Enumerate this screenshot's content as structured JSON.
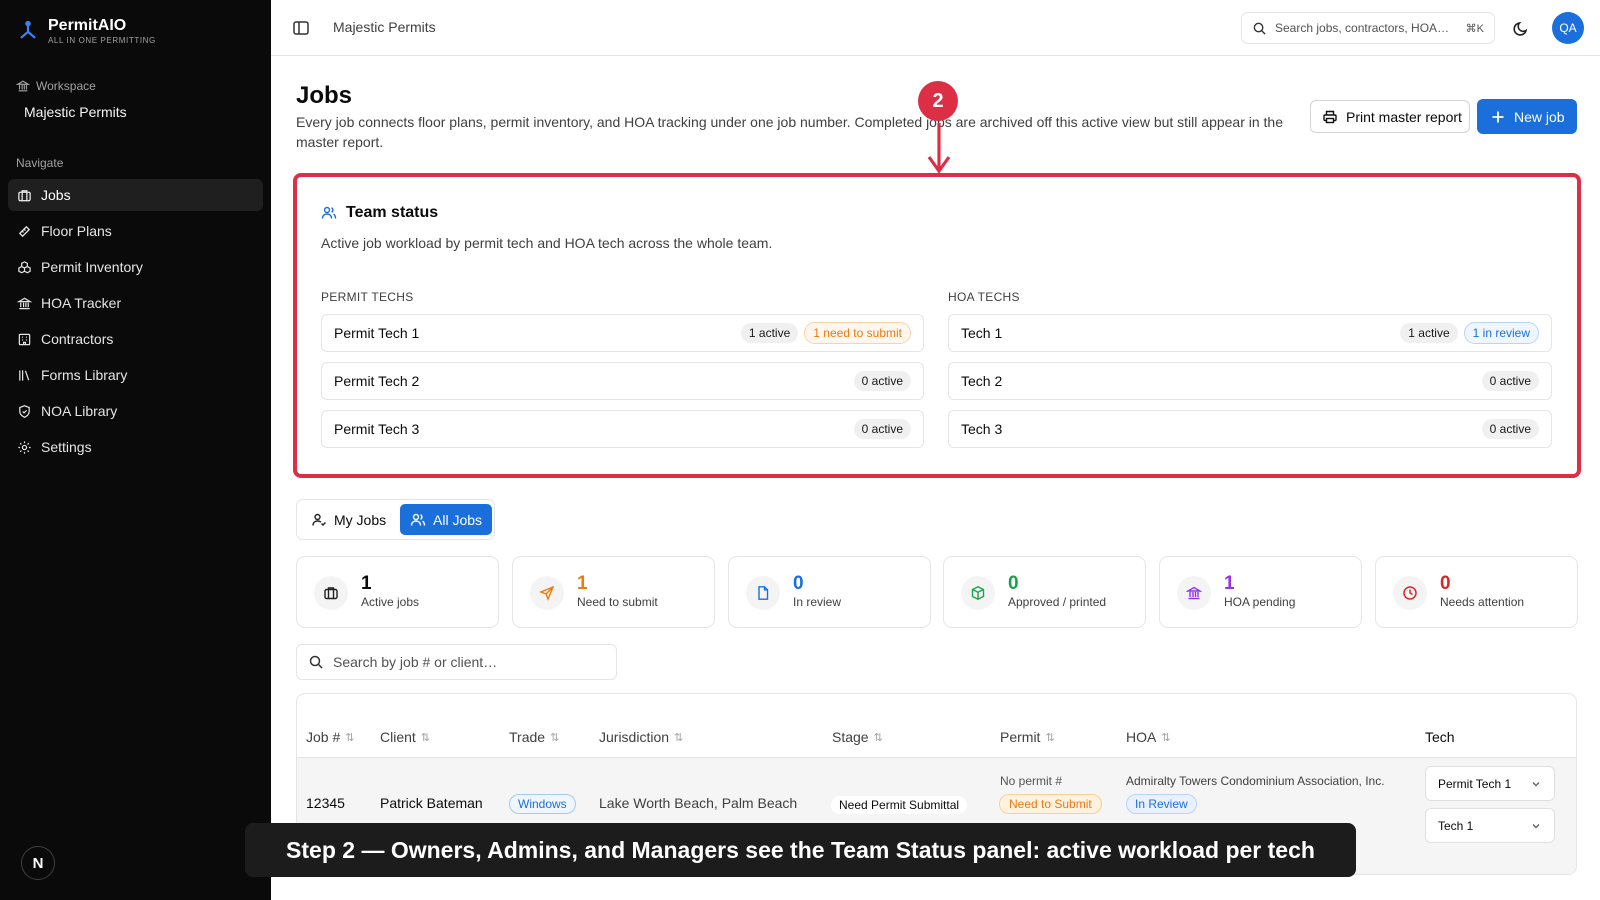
{
  "brand": {
    "name": "PermitAIO",
    "tagline": "ALL IN ONE PERMITTING"
  },
  "sidebar": {
    "workspace_label": "Workspace",
    "workspace_name": "Majestic Permits",
    "navigate_label": "Navigate",
    "items": [
      {
        "label": "Jobs",
        "icon": "briefcase-icon",
        "active": true
      },
      {
        "label": "Floor Plans",
        "icon": "ruler-icon"
      },
      {
        "label": "Permit Inventory",
        "icon": "boxes-icon"
      },
      {
        "label": "HOA Tracker",
        "icon": "bank-icon"
      },
      {
        "label": "Contractors",
        "icon": "building-icon"
      },
      {
        "label": "Forms Library",
        "icon": "library-icon"
      },
      {
        "label": "NOA Library",
        "icon": "shield-icon"
      },
      {
        "label": "Settings",
        "icon": "gear-icon"
      }
    ],
    "bottom_avatar": "N"
  },
  "topbar": {
    "title": "Majestic Permits",
    "search_placeholder": "Search jobs, contractors, HOA…",
    "search_shortcut": "⌘K",
    "avatar": "QA"
  },
  "header": {
    "title": "Jobs",
    "description": "Every job connects floor plans, permit inventory, and HOA tracking under one job number. Completed jobs are archived off this active view but still appear in the master report.",
    "print_label": "Print master report",
    "new_label": "New job"
  },
  "step_marker": "2",
  "team": {
    "title": "Team status",
    "subtitle": "Active job workload by permit tech and HOA tech across the whole team.",
    "permit_label": "PERMIT TECHS",
    "hoa_label": "HOA TECHS",
    "permit_techs": [
      {
        "name": "Permit Tech 1",
        "active": "1 active",
        "extra": "1 need to submit"
      },
      {
        "name": "Permit Tech 2",
        "active": "0 active"
      },
      {
        "name": "Permit Tech 3",
        "active": "0 active"
      }
    ],
    "hoa_techs": [
      {
        "name": "Tech 1",
        "active": "1 active",
        "extra": "1 in review"
      },
      {
        "name": "Tech 2",
        "active": "0 active"
      },
      {
        "name": "Tech 3",
        "active": "0 active"
      }
    ]
  },
  "tabs": {
    "my": "My Jobs",
    "all": "All Jobs"
  },
  "stats": [
    {
      "value": "1",
      "label": "Active jobs",
      "color": "#0a0a0a",
      "icon": "briefcase-icon"
    },
    {
      "value": "1",
      "label": "Need to submit",
      "color": "#ea7a12",
      "icon": "send-icon"
    },
    {
      "value": "0",
      "label": "In review",
      "color": "#1a6fdb",
      "icon": "file-icon"
    },
    {
      "value": "0",
      "label": "Approved / printed",
      "color": "#16a34a",
      "icon": "package-check-icon"
    },
    {
      "value": "1",
      "label": "HOA pending",
      "color": "#9333ea",
      "icon": "bank-icon"
    },
    {
      "value": "0",
      "label": "Needs attention",
      "color": "#dc2626",
      "icon": "clock-icon"
    }
  ],
  "job_search_placeholder": "Search by job # or client…",
  "table": {
    "headers": [
      "Job #",
      "Client",
      "Trade",
      "Jurisdiction",
      "Stage",
      "Permit",
      "HOA",
      "Tech"
    ],
    "row": {
      "job": "12345",
      "client": "Patrick Bateman",
      "trade": "Windows",
      "jurisdiction": "Lake Worth Beach, Palm Beach",
      "stage": "Need Permit Submittal",
      "permit_no": "No permit #",
      "permit_status": "Need to Submit",
      "hoa_name": "Admiralty Towers Condominium Association, Inc.",
      "hoa_status": "In Review",
      "permit_tech": "Permit Tech 1",
      "hoa_tech": "Tech 1"
    }
  },
  "caption": "Step 2 — Owners, Admins, and Managers see the Team Status panel: active workload per tech",
  "colors": {
    "accent": "#1a6fdb",
    "highlight": "#dc2f45",
    "sidebar": "#0a0a0a"
  }
}
